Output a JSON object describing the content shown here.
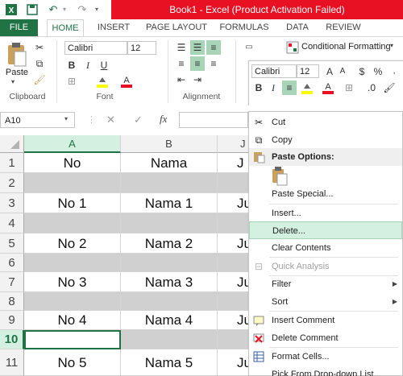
{
  "window": {
    "title": "Book1 -  Excel (Product Activation Failed)"
  },
  "ribbon_tabs": [
    "FILE",
    "HOME",
    "INSERT",
    "PAGE LAYOUT",
    "FORMULAS",
    "DATA",
    "REVIEW"
  ],
  "ribbon": {
    "paste_label": "Paste",
    "clipboard_label": "Clipboard",
    "font_label": "Font",
    "alignment_label": "Alignment",
    "font_name": "Calibri",
    "font_size": "12",
    "conditional_formatting": "Conditional Formatting",
    "bold": "B",
    "italic": "I",
    "underline": "U"
  },
  "mini_toolbar": {
    "font_name": "Calibri",
    "font_size": "12",
    "bold": "B",
    "italic": "I"
  },
  "formula_bar": {
    "name_box": "A10",
    "fx": "fx",
    "cancel": "✕",
    "enter": "✓"
  },
  "columns": [
    "A",
    "B",
    "J"
  ],
  "rows": [
    {
      "num": "1",
      "a": "No",
      "b": "Nama",
      "c": "J",
      "gray": false
    },
    {
      "num": "2",
      "a": "",
      "b": "",
      "c": "",
      "gray": true
    },
    {
      "num": "3",
      "a": "No 1",
      "b": "Nama 1",
      "c": "Ju",
      "gray": false
    },
    {
      "num": "4",
      "a": "",
      "b": "",
      "c": "",
      "gray": true
    },
    {
      "num": "5",
      "a": "No 2",
      "b": "Nama 2",
      "c": "Ju",
      "gray": false
    },
    {
      "num": "6",
      "a": "",
      "b": "",
      "c": "",
      "gray": true
    },
    {
      "num": "7",
      "a": "No 3",
      "b": "Nama 3",
      "c": "Ju",
      "gray": false
    },
    {
      "num": "8",
      "a": "",
      "b": "",
      "c": "",
      "gray": true
    },
    {
      "num": "9",
      "a": "No 4",
      "b": "Nama 4",
      "c": "Ju",
      "gray": false
    },
    {
      "num": "10",
      "a": "",
      "b": "",
      "c": "",
      "gray": true
    },
    {
      "num": "11",
      "a": "No 5",
      "b": "Nama 5",
      "c": "Ju",
      "gray": false
    }
  ],
  "context_menu": {
    "cut": "Cut",
    "copy": "Copy",
    "paste_options": "Paste Options:",
    "paste_special": "Paste Special...",
    "insert": "Insert...",
    "delete": "Delete...",
    "clear_contents": "Clear Contents",
    "quick_analysis": "Quick Analysis",
    "filter": "Filter",
    "sort": "Sort",
    "insert_comment": "Insert Comment",
    "delete_comment": "Delete Comment",
    "format_cells": "Format Cells...",
    "pick_from_dropdown": "Pick From Drop-down List..."
  },
  "colors": {
    "excel_green": "#217346",
    "title_red": "#e81123",
    "highlight": "#d3f0e0"
  }
}
